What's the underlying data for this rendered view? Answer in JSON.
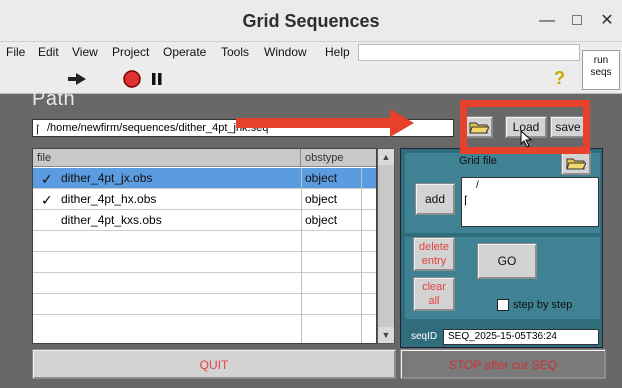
{
  "window": {
    "title": "Grid Sequences"
  },
  "menu": [
    "File",
    "Edit",
    "View",
    "Project",
    "Operate",
    "Tools",
    "Window",
    "Help"
  ],
  "toolbar": {
    "run_label": "run\nseqs",
    "help_icon": "?"
  },
  "path_section": {
    "label": "Path",
    "value": "/home/newfirm/sequences/dither_4pt_jhk.seq",
    "load_label": "Load",
    "save_label": "save"
  },
  "table": {
    "columns": [
      "file",
      "obstype"
    ],
    "rows": [
      {
        "file": "dither_4pt_jx.obs",
        "obstype": "object",
        "checked": true,
        "selected": true
      },
      {
        "file": "dither_4pt_hx.obs",
        "obstype": "object",
        "checked": true,
        "selected": false
      },
      {
        "file": "dither_4pt_kxs.obs",
        "obstype": "object",
        "checked": false,
        "selected": false
      }
    ]
  },
  "grid": {
    "label": "Grid file",
    "add_label": "add",
    "field_value": "/",
    "delete_label": "delete\nentry",
    "clear_label": "clear\nall",
    "go_label": "GO",
    "step_label": "step by step",
    "seqid_label": "seqID",
    "seqid_value": "SEQ_2025-15-05T36:24"
  },
  "bottom": {
    "quit_label": "QUIT",
    "stop_label": "STOP after cur SEQ"
  },
  "colors": {
    "accent_red": "#e8412b",
    "panel_teal": "#2f6d7c",
    "selected_row": "#5b9bdf"
  }
}
